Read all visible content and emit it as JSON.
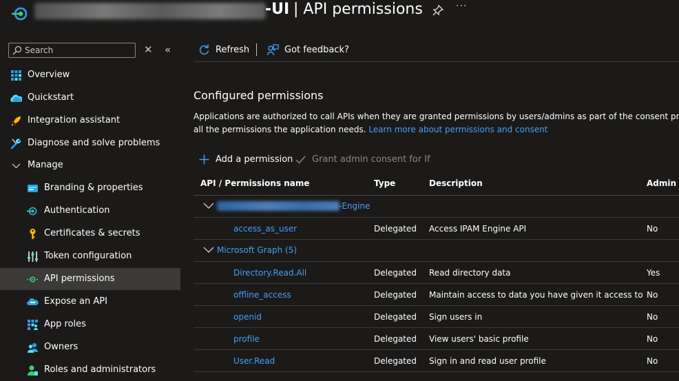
{
  "header": {
    "title_suffix": "-UI",
    "title_rest": "| API permissions",
    "more_label": "···"
  },
  "sidebar": {
    "search_placeholder": "Search",
    "clear_glyph": "✕",
    "collapse_glyph": "«",
    "items": [
      {
        "label": "Overview",
        "icon": "overview-icon"
      },
      {
        "label": "Quickstart",
        "icon": "quickstart-icon"
      },
      {
        "label": "Integration assistant",
        "icon": "rocket-icon"
      },
      {
        "label": "Diagnose and solve problems",
        "icon": "wrench-icon"
      },
      {
        "label": "Manage",
        "icon": "chevron-down-icon"
      },
      {
        "label": "Branding & properties",
        "icon": "branding-icon"
      },
      {
        "label": "Authentication",
        "icon": "authentication-icon"
      },
      {
        "label": "Certificates & secrets",
        "icon": "key-icon"
      },
      {
        "label": "Token configuration",
        "icon": "token-icon"
      },
      {
        "label": "API permissions",
        "icon": "api-permissions-icon",
        "active": true
      },
      {
        "label": "Expose an API",
        "icon": "cloud-icon"
      },
      {
        "label": "App roles",
        "icon": "app-roles-icon"
      },
      {
        "label": "Owners",
        "icon": "owners-icon"
      },
      {
        "label": "Roles and administrators",
        "icon": "roles-icon"
      }
    ]
  },
  "toolbar": {
    "refresh_label": "Refresh",
    "feedback_label": "Got feedback?"
  },
  "main": {
    "section_title": "Configured permissions",
    "desc_line1": "Applications are authorized to call APIs when they are granted permissions by users/admins as part of the consent process.",
    "desc_line2": "all the permissions the application needs.",
    "learn_more": "Learn more about permissions and consent",
    "add_permission_label": "Add a permission",
    "grant_consent_label": "Grant admin consent for If"
  },
  "table": {
    "headers": {
      "name": "API / Permissions name",
      "type": "Type",
      "description": "Description",
      "admin": "Admin c"
    },
    "groups": [
      {
        "name_suffix": "-Engine",
        "permissions": [
          {
            "name": "access_as_user",
            "type": "Delegated",
            "description": "Access IPAM Engine API",
            "admin": "No"
          }
        ]
      },
      {
        "name": "Microsoft Graph (5)",
        "permissions": [
          {
            "name": "Directory.Read.All",
            "type": "Delegated",
            "description": "Read directory data",
            "admin": "Yes"
          },
          {
            "name": "offline_access",
            "type": "Delegated",
            "description": "Maintain access to data you have given it access to",
            "admin": "No"
          },
          {
            "name": "openid",
            "type": "Delegated",
            "description": "Sign users in",
            "admin": "No"
          },
          {
            "name": "profile",
            "type": "Delegated",
            "description": "View users' basic profile",
            "admin": "No"
          },
          {
            "name": "User.Read",
            "type": "Delegated",
            "description": "Sign in and read user profile",
            "admin": "No"
          }
        ]
      }
    ]
  },
  "colors": {
    "background": "#1b1a19",
    "link": "#479ef5",
    "active_nav": "#3b3a39",
    "brand_green": "#3ccc7a"
  }
}
